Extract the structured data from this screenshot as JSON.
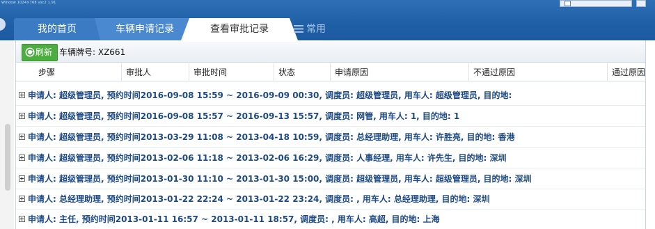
{
  "header": {
    "tiny_text": "Window 1024×768 vsc2 1.91",
    "tabs": [
      {
        "label": "我的首页"
      },
      {
        "label": "车辆申请记录"
      },
      {
        "label": "查看审批记录"
      },
      {
        "label": "常用"
      }
    ]
  },
  "toolbar": {
    "refresh_label": "刷新",
    "plate_label": "车辆牌号: XZ661"
  },
  "table": {
    "columns": [
      "步骤",
      "审批人",
      "审批时间",
      "状态",
      "申请原因",
      "不通过原因",
      "通过原因"
    ]
  },
  "groups": [
    "申请人: 超级管理员, 预约时间2016-09-08 15:59 ~ 2016-09-09 00:30, 调度员: 超级管理员, 用车人: 超级管理员, 目的地:",
    "申请人: 超级管理员, 预约时间2016-09-08 15:57 ~ 2016-09-13 15:57, 调度员: 网管, 用车人: 1, 目的地: 1",
    "申请人: 超级管理员, 预约时间2013-03-29 11:08 ~ 2013-04-18 10:59, 调度员: 总经理助理, 用车人: 许胜亮, 目的地: 香港",
    "申请人: 超级管理员, 预约时间2013-02-06 11:18 ~ 2013-02-06 16:29, 调度员: 人事经理, 用车人: 许先生, 目的地: 深圳",
    "申请人: 超级管理员, 预约时间2013-01-30 11:10 ~ 2013-01-30 15:00, 调度员: 超级管理员, 用车人: 超级管理员, 目的地: 深圳",
    "申请人: 总经理助理, 预约时间2013-01-22 22:24 ~ 2013-01-22 23:24, 调度员: , 用车人: 总经理助理, 目的地: 深圳",
    "申请人: 主任, 预约时间2013-01-11 16:57 ~ 2013-01-11 18:57, 调度员: , 用车人: 高超, 目的地: 上海"
  ]
}
